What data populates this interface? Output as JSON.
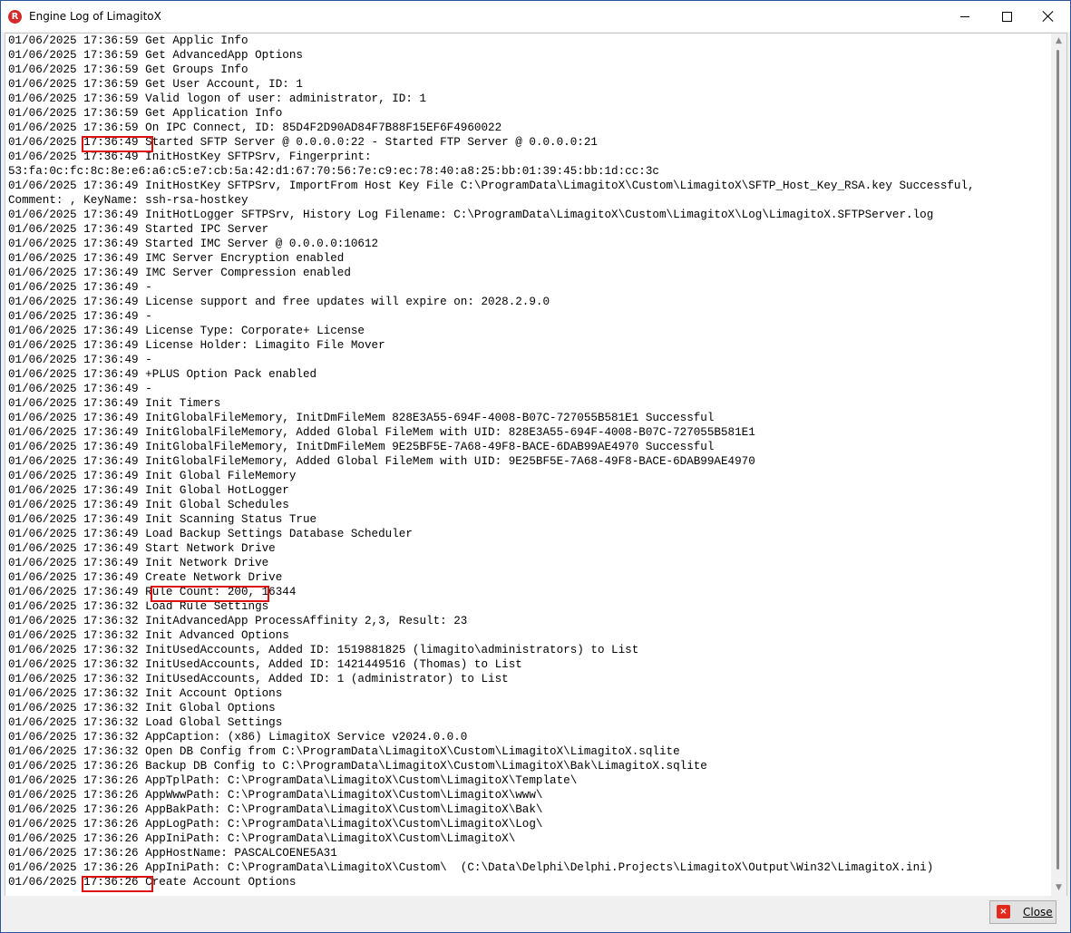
{
  "window": {
    "title": "Engine Log of LimagitoX",
    "icon_letter": "R",
    "controls": {
      "minimize": "minimize",
      "maximize": "maximize",
      "close": "close"
    }
  },
  "log": {
    "lines": [
      "01/06/2025 17:36:59 Get Applic Info",
      "01/06/2025 17:36:59 Get AdvancedApp Options",
      "01/06/2025 17:36:59 Get Groups Info",
      "01/06/2025 17:36:59 Get User Account, ID: 1",
      "01/06/2025 17:36:59 Valid logon of user: administrator, ID: 1",
      "01/06/2025 17:36:59 Get Application Info",
      "01/06/2025 17:36:59 On IPC Connect, ID: 85D4F2D90AD84F7B88F15EF6F4960022",
      "01/06/2025 17:36:49 Started SFTP Server @ 0.0.0.0:22 - Started FTP Server @ 0.0.0.0:21",
      "01/06/2025 17:36:49 InitHostKey SFTPSrv, Fingerprint:",
      "53:fa:0c:fc:8c:8e:e6:a6:c5:e7:cb:5a:42:d1:67:70:56:7e:c9:ec:78:40:a8:25:bb:01:39:45:bb:1d:cc:3c",
      "01/06/2025 17:36:49 InitHostKey SFTPSrv, ImportFrom Host Key File C:\\ProgramData\\LimagitoX\\Custom\\LimagitoX\\SFTP_Host_Key_RSA.key Successful,",
      "Comment: , KeyName: ssh-rsa-hostkey",
      "01/06/2025 17:36:49 InitHotLogger SFTPSrv, History Log Filename: C:\\ProgramData\\LimagitoX\\Custom\\LimagitoX\\Log\\LimagitoX.SFTPServer.log",
      "01/06/2025 17:36:49 Started IPC Server",
      "01/06/2025 17:36:49 Started IMC Server @ 0.0.0.0:10612",
      "01/06/2025 17:36:49 IMC Server Encryption enabled",
      "01/06/2025 17:36:49 IMC Server Compression enabled",
      "01/06/2025 17:36:49 -",
      "01/06/2025 17:36:49 License support and free updates will expire on: 2028.2.9.0",
      "01/06/2025 17:36:49 -",
      "01/06/2025 17:36:49 License Type: Corporate+ License",
      "01/06/2025 17:36:49 License Holder: Limagito File Mover",
      "01/06/2025 17:36:49 -",
      "01/06/2025 17:36:49 +PLUS Option Pack enabled",
      "01/06/2025 17:36:49 -",
      "01/06/2025 17:36:49 Init Timers",
      "01/06/2025 17:36:49 InitGlobalFileMemory, InitDmFileMem 828E3A55-694F-4008-B07C-727055B581E1 Successful",
      "01/06/2025 17:36:49 InitGlobalFileMemory, Added Global FileMem with UID: 828E3A55-694F-4008-B07C-727055B581E1",
      "01/06/2025 17:36:49 InitGlobalFileMemory, InitDmFileMem 9E25BF5E-7A68-49F8-BACE-6DAB99AE4970 Successful",
      "01/06/2025 17:36:49 InitGlobalFileMemory, Added Global FileMem with UID: 9E25BF5E-7A68-49F8-BACE-6DAB99AE4970",
      "01/06/2025 17:36:49 Init Global FileMemory",
      "01/06/2025 17:36:49 Init Global HotLogger",
      "01/06/2025 17:36:49 Init Global Schedules",
      "01/06/2025 17:36:49 Init Scanning Status True",
      "01/06/2025 17:36:49 Load Backup Settings Database Scheduler",
      "01/06/2025 17:36:49 Start Network Drive",
      "01/06/2025 17:36:49 Init Network Drive",
      "01/06/2025 17:36:49 Create Network Drive",
      "01/06/2025 17:36:49 Rule Count: 200, 16344",
      "01/06/2025 17:36:32 Load Rule Settings",
      "01/06/2025 17:36:32 InitAdvancedApp ProcessAffinity 2,3, Result: 23",
      "01/06/2025 17:36:32 Init Advanced Options",
      "01/06/2025 17:36:32 InitUsedAccounts, Added ID: 1519881825 (limagito\\administrators) to List",
      "01/06/2025 17:36:32 InitUsedAccounts, Added ID: 1421449516 (Thomas) to List",
      "01/06/2025 17:36:32 InitUsedAccounts, Added ID: 1 (administrator) to List",
      "01/06/2025 17:36:32 Init Account Options",
      "01/06/2025 17:36:32 Init Global Options",
      "01/06/2025 17:36:32 Load Global Settings",
      "01/06/2025 17:36:32 AppCaption: (x86) LimagitoX Service v2024.0.0.0",
      "01/06/2025 17:36:32 Open DB Config from C:\\ProgramData\\LimagitoX\\Custom\\LimagitoX\\LimagitoX.sqlite",
      "01/06/2025 17:36:26 Backup DB Config to C:\\ProgramData\\LimagitoX\\Custom\\LimagitoX\\Bak\\LimagitoX.sqlite",
      "01/06/2025 17:36:26 AppTplPath: C:\\ProgramData\\LimagitoX\\Custom\\LimagitoX\\Template\\",
      "01/06/2025 17:36:26 AppWwwPath: C:\\ProgramData\\LimagitoX\\Custom\\LimagitoX\\www\\",
      "01/06/2025 17:36:26 AppBakPath: C:\\ProgramData\\LimagitoX\\Custom\\LimagitoX\\Bak\\",
      "01/06/2025 17:36:26 AppLogPath: C:\\ProgramData\\LimagitoX\\Custom\\LimagitoX\\Log\\",
      "01/06/2025 17:36:26 AppIniPath: C:\\ProgramData\\LimagitoX\\Custom\\LimagitoX\\",
      "01/06/2025 17:36:26 AppHostName: PASCALCOENE5A31",
      "01/06/2025 17:36:26 AppIniPath: C:\\ProgramData\\LimagitoX\\Custom\\  (C:\\Data\\Delphi\\Delphi.Projects\\LimagitoX\\Output\\Win32\\LimagitoX.ini)",
      "01/06/2025 17:36:26 Create Account Options"
    ]
  },
  "footer": {
    "close_label": "Close",
    "close_icon_letter": "×"
  }
}
